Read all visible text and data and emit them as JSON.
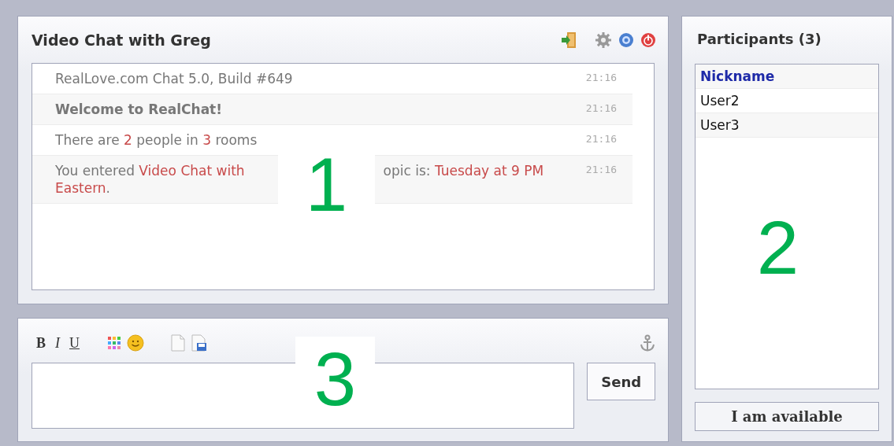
{
  "chat": {
    "title": "Video Chat with Greg",
    "messages": [
      {
        "kind": "plain",
        "segments": [
          {
            "parts": [
              {
                "text": "RealLove.com Chat 5.0, Build #649",
                "highlight": false
              }
            ]
          }
        ],
        "time": "21:16"
      },
      {
        "kind": "bold",
        "segments": [
          {
            "parts": [
              {
                "text": "Welcome to RealChat!",
                "highlight": false
              }
            ]
          }
        ],
        "time": "21:16"
      },
      {
        "kind": "plain",
        "segments": [
          {
            "parts": [
              {
                "text": "There are ",
                "highlight": false
              },
              {
                "text": "2",
                "highlight": true
              },
              {
                "text": " people in ",
                "highlight": false
              },
              {
                "text": "3",
                "highlight": true
              },
              {
                "text": " rooms",
                "highlight": false
              }
            ]
          }
        ],
        "time": "21:16"
      },
      {
        "kind": "plain",
        "segments": [
          {
            "parts": [
              {
                "text": "You entered ",
                "highlight": false
              },
              {
                "text": "Video Chat with",
                "highlight": true
              }
            ]
          },
          {
            "kind": "after_gap",
            "parts": [
              {
                "text": "opic is: ",
                "highlight": false
              },
              {
                "text": "Tuesday at 9 PM",
                "highlight": true
              }
            ]
          },
          {
            "kind": "next_line",
            "parts": [
              {
                "text": "Eastern",
                "highlight": true
              },
              {
                "text": ".",
                "highlight": false
              }
            ]
          }
        ],
        "time": "21:16"
      }
    ]
  },
  "composer": {
    "format_buttons": [
      "B",
      "I",
      "U"
    ],
    "send_button": "Send"
  },
  "participants": {
    "title": "Participants (3)",
    "column": "Nickname",
    "rows": [
      "User2",
      "User3"
    ],
    "status_button": "I am available"
  },
  "annotations": [
    {
      "label": "1"
    },
    {
      "label": "2"
    },
    {
      "label": "3"
    }
  ]
}
